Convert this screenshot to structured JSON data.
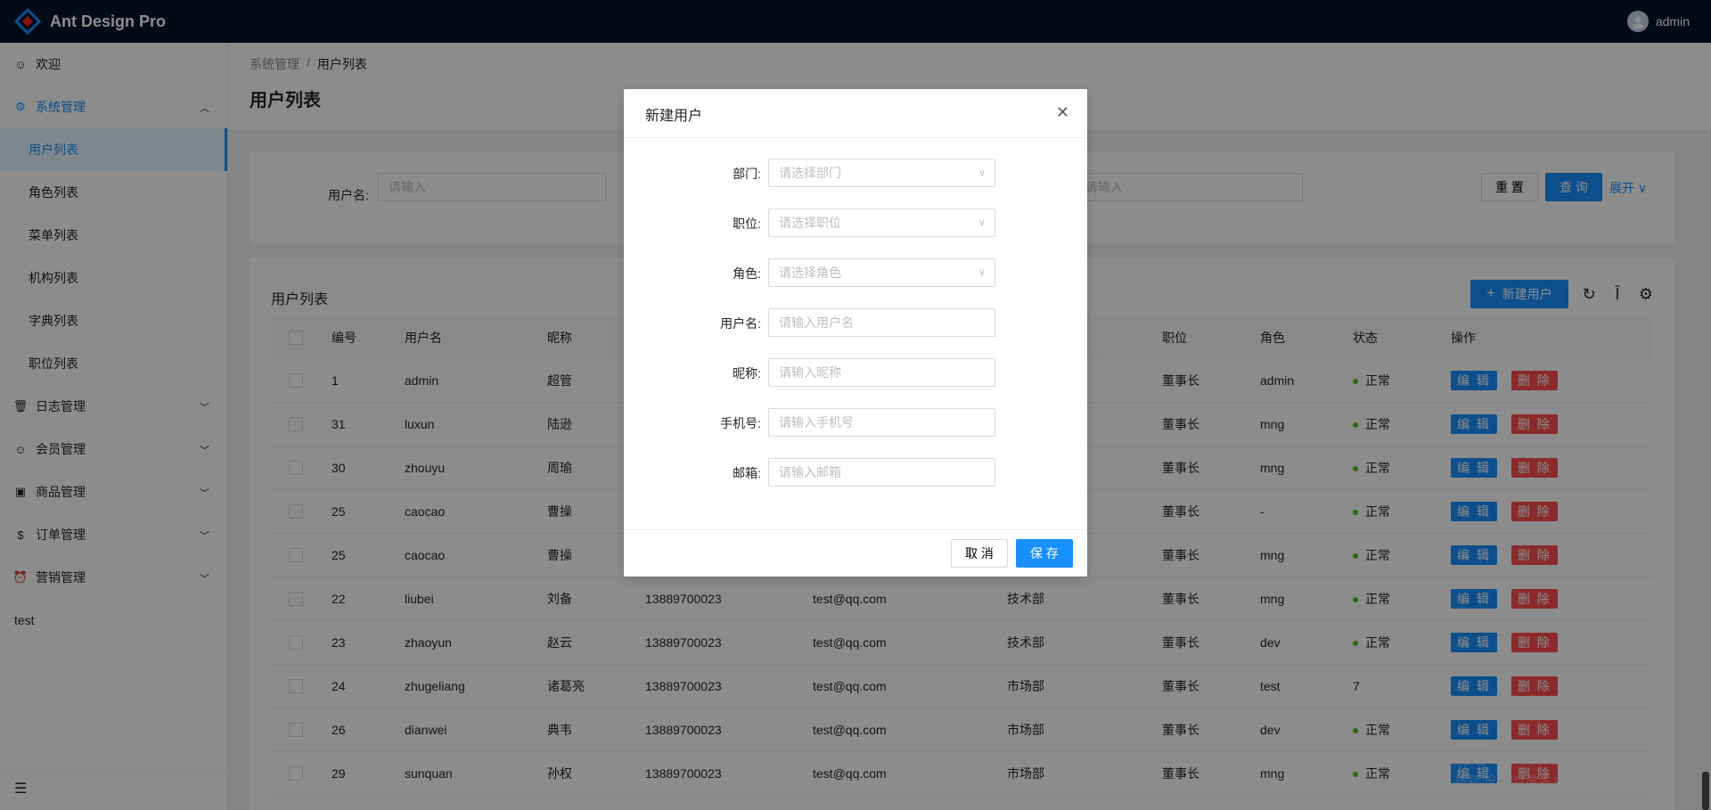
{
  "header": {
    "app_title": "Ant Design Pro",
    "user_name": "admin"
  },
  "sidebar": {
    "items": [
      {
        "label": "欢迎",
        "icon": "smile-icon"
      },
      {
        "label": "系统管理",
        "icon": "setting-icon",
        "open": true
      },
      {
        "label": "日志管理",
        "icon": "delete-icon"
      },
      {
        "label": "会员管理",
        "icon": "smile-icon"
      },
      {
        "label": "商品管理",
        "icon": "gift-icon"
      },
      {
        "label": "订单管理",
        "icon": "dollar-icon"
      },
      {
        "label": "营销管理",
        "icon": "alarm-icon"
      }
    ],
    "sub_items": [
      "用户列表",
      "角色列表",
      "菜单列表",
      "机构列表",
      "字典列表",
      "职位列表"
    ],
    "plain_item": "test"
  },
  "breadcrumb": [
    "系统管理",
    "用户列表"
  ],
  "page_title": "用户列表",
  "search": {
    "username_label": "用户名:",
    "username_placeholder": "请输入",
    "other_placeholder": "请输入",
    "reset_label": "重 置",
    "query_label": "查 询",
    "expand_label": "展开"
  },
  "table": {
    "title": "用户列表",
    "new_button": "新建用户",
    "columns": [
      "编号",
      "用户名",
      "昵称",
      "职位",
      "角色",
      "状态",
      "操作"
    ],
    "edit_label": "编 辑",
    "delete_label": "删 除",
    "rows": [
      {
        "id": "1",
        "username": "admin",
        "nickname": "超管",
        "phone": "",
        "email": "",
        "dept": "",
        "position": "董事长",
        "role": "admin",
        "status": "正常",
        "status_dot": true
      },
      {
        "id": "31",
        "username": "luxun",
        "nickname": "陆逊",
        "phone": "",
        "email": "",
        "dept": "",
        "position": "董事长",
        "role": "mng",
        "status": "正常",
        "status_dot": true
      },
      {
        "id": "30",
        "username": "zhouyu",
        "nickname": "周瑜",
        "phone": "",
        "email": "",
        "dept": "",
        "position": "董事长",
        "role": "mng",
        "status": "正常",
        "status_dot": true
      },
      {
        "id": "25",
        "username": "caocao",
        "nickname": "曹操",
        "phone": "",
        "email": "",
        "dept": "",
        "position": "董事长",
        "role": "-",
        "status": "正常",
        "status_dot": true
      },
      {
        "id": "25",
        "username": "caocao",
        "nickname": "曹操",
        "phone": "",
        "email": "",
        "dept": "",
        "position": "董事长",
        "role": "mng",
        "status": "正常",
        "status_dot": true
      },
      {
        "id": "22",
        "username": "liubei",
        "nickname": "刘备",
        "phone": "13889700023",
        "email": "test@qq.com",
        "dept": "技术部",
        "position": "董事长",
        "role": "mng",
        "status": "正常",
        "status_dot": true
      },
      {
        "id": "23",
        "username": "zhaoyun",
        "nickname": "赵云",
        "phone": "13889700023",
        "email": "test@qq.com",
        "dept": "技术部",
        "position": "董事长",
        "role": "dev",
        "status": "正常",
        "status_dot": true
      },
      {
        "id": "24",
        "username": "zhugeliang",
        "nickname": "诸葛亮",
        "phone": "13889700023",
        "email": "test@qq.com",
        "dept": "市场部",
        "position": "董事长",
        "role": "test",
        "status": "7",
        "status_dot": false
      },
      {
        "id": "26",
        "username": "dianwei",
        "nickname": "典韦",
        "phone": "13889700023",
        "email": "test@qq.com",
        "dept": "市场部",
        "position": "董事长",
        "role": "dev",
        "status": "正常",
        "status_dot": true
      },
      {
        "id": "29",
        "username": "sunquan",
        "nickname": "孙权",
        "phone": "13889700023",
        "email": "test@qq.com",
        "dept": "市场部",
        "position": "董事长",
        "role": "mng",
        "status": "正常",
        "status_dot": true
      }
    ]
  },
  "modal": {
    "title": "新建用户",
    "fields": [
      {
        "label": "部门:",
        "placeholder": "请选择部门",
        "type": "select"
      },
      {
        "label": "职位:",
        "placeholder": "请选择职位",
        "type": "select"
      },
      {
        "label": "角色:",
        "placeholder": "请选择角色",
        "type": "select"
      },
      {
        "label": "用户名:",
        "placeholder": "请输入用户名",
        "type": "input"
      },
      {
        "label": "昵称:",
        "placeholder": "请输入昵称",
        "type": "input"
      },
      {
        "label": "手机号:",
        "placeholder": "请输入手机号",
        "type": "input"
      },
      {
        "label": "邮箱:",
        "placeholder": "请输入邮箱",
        "type": "input"
      }
    ],
    "cancel_label": "取 消",
    "save_label": "保 存"
  },
  "watermark": {
    "line1": "激活 Windows",
    "line2": "转到\"设置\"以激活 Windows。"
  },
  "colors": {
    "primary": "#1890ff",
    "danger": "#ff4d4f",
    "success": "#52c41a",
    "header_bg": "#001529"
  }
}
